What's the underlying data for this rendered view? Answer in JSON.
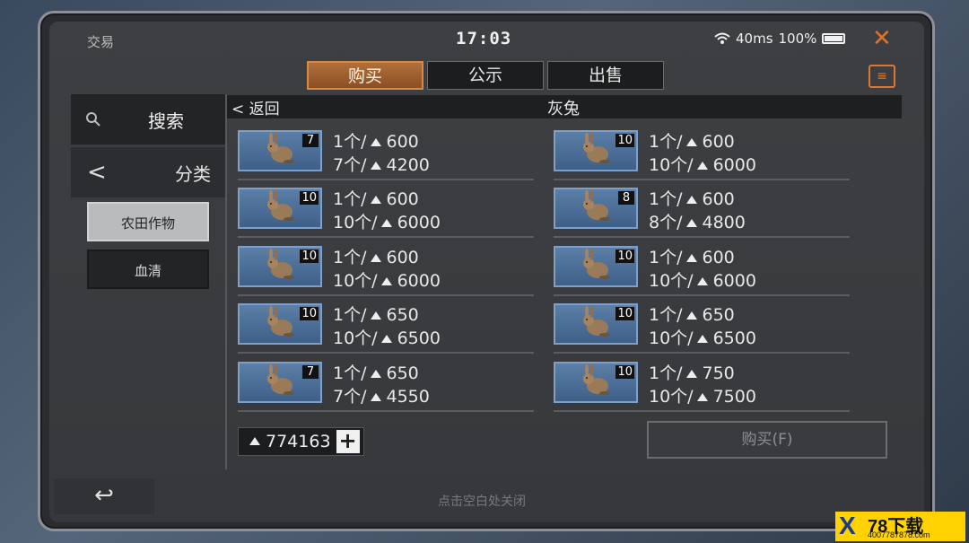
{
  "header": {
    "title": "交易",
    "time": "17:03",
    "ping": "40ms",
    "battery": "100%"
  },
  "tabs": [
    {
      "label": "购买",
      "active": true
    },
    {
      "label": "公示",
      "active": false
    },
    {
      "label": "出售",
      "active": false
    }
  ],
  "sidebar": {
    "search_label": "搜索",
    "category_label": "分类",
    "categories": [
      "农田作物",
      "血清"
    ]
  },
  "list": {
    "back_label": "返回",
    "item_title": "灰兔",
    "listings": [
      {
        "qty": "7",
        "line1": "1个/",
        "unit_price": "600",
        "line2": "7个/",
        "total": "4200"
      },
      {
        "qty": "10",
        "line1": "1个/",
        "unit_price": "600",
        "line2": "10个/",
        "total": "6000"
      },
      {
        "qty": "10",
        "line1": "1个/",
        "unit_price": "600",
        "line2": "10个/",
        "total": "6000"
      },
      {
        "qty": "8",
        "line1": "1个/",
        "unit_price": "600",
        "line2": "8个/",
        "total": "4800"
      },
      {
        "qty": "10",
        "line1": "1个/",
        "unit_price": "600",
        "line2": "10个/",
        "total": "6000"
      },
      {
        "qty": "10",
        "line1": "1个/",
        "unit_price": "600",
        "line2": "10个/",
        "total": "6000"
      },
      {
        "qty": "10",
        "line1": "1个/",
        "unit_price": "650",
        "line2": "10个/",
        "total": "6500"
      },
      {
        "qty": "10",
        "line1": "1个/",
        "unit_price": "650",
        "line2": "10个/",
        "total": "6500"
      },
      {
        "qty": "7",
        "line1": "1个/",
        "unit_price": "650",
        "line2": "7个/",
        "total": "4550"
      },
      {
        "qty": "10",
        "line1": "1个/",
        "unit_price": "750",
        "line2": "10个/",
        "total": "7500"
      }
    ]
  },
  "footer": {
    "balance": "774163",
    "buy_label": "购买(F)",
    "hint": "点击空白处关闭"
  },
  "watermark": {
    "brand": "78下载",
    "site": "4007787878.com"
  },
  "colors": {
    "accent": "#d88a45",
    "close": "#e0742a",
    "thumb_bg": "#4a6d96"
  }
}
